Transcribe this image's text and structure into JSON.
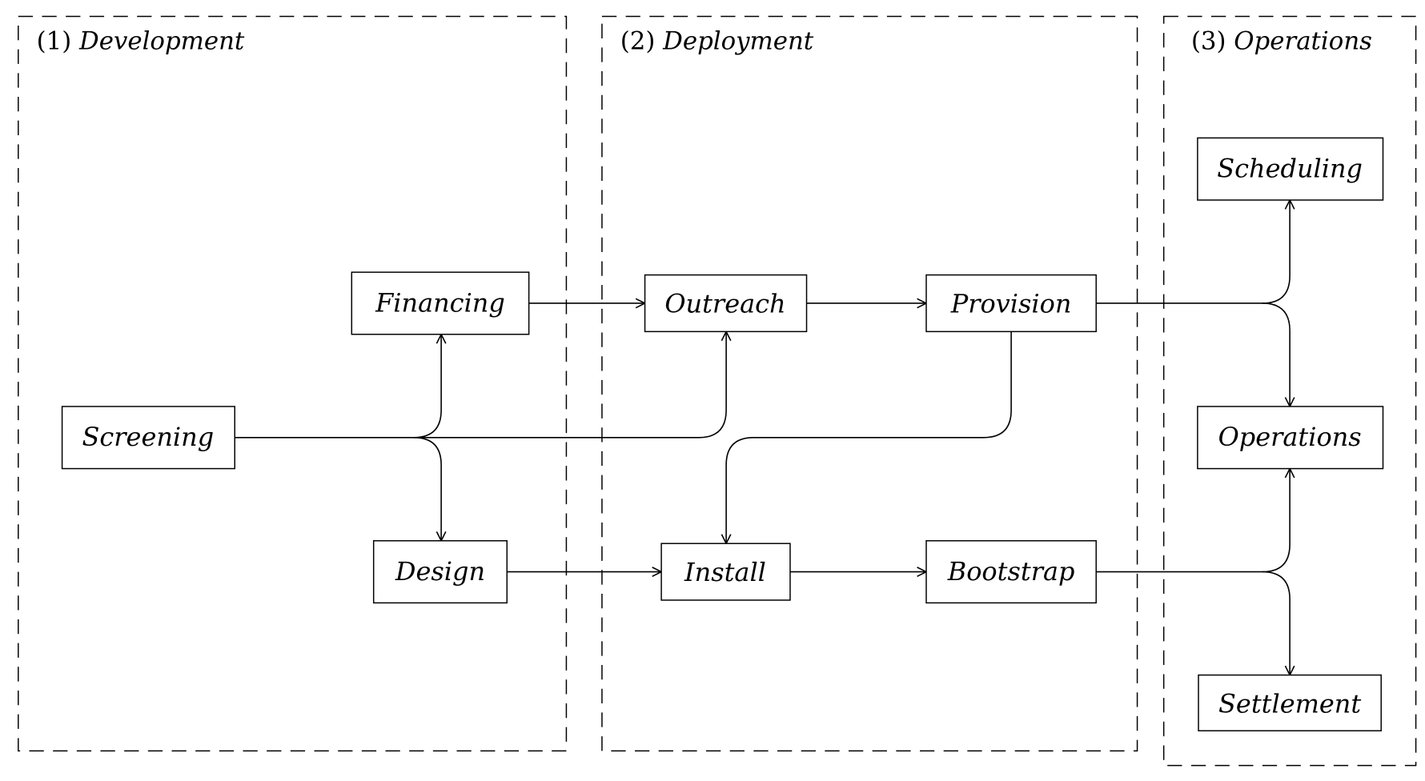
{
  "groups": [
    {
      "num": "(1)",
      "name": "Development"
    },
    {
      "num": "(2)",
      "name": "Deployment"
    },
    {
      "num": "(3)",
      "name": "Operations"
    }
  ],
  "nodes": {
    "screening": "Screening",
    "financing": "Financing",
    "design": "Design",
    "outreach": "Outreach",
    "provision": "Provision",
    "install": "Install",
    "bootstrap": "Bootstrap",
    "scheduling": "Scheduling",
    "operations": "Operations",
    "settlement": "Settlement"
  },
  "edges": [
    [
      "Screening",
      "Financing"
    ],
    [
      "Screening",
      "Design"
    ],
    [
      "Screening",
      "Outreach"
    ],
    [
      "Financing",
      "Outreach"
    ],
    [
      "Outreach",
      "Provision"
    ],
    [
      "Design",
      "Install"
    ],
    [
      "Install",
      "Bootstrap"
    ],
    [
      "Provision",
      "Install"
    ],
    [
      "Provision",
      "Scheduling"
    ],
    [
      "Provision",
      "Operations"
    ],
    [
      "Bootstrap",
      "Operations"
    ],
    [
      "Bootstrap",
      "Settlement"
    ]
  ]
}
